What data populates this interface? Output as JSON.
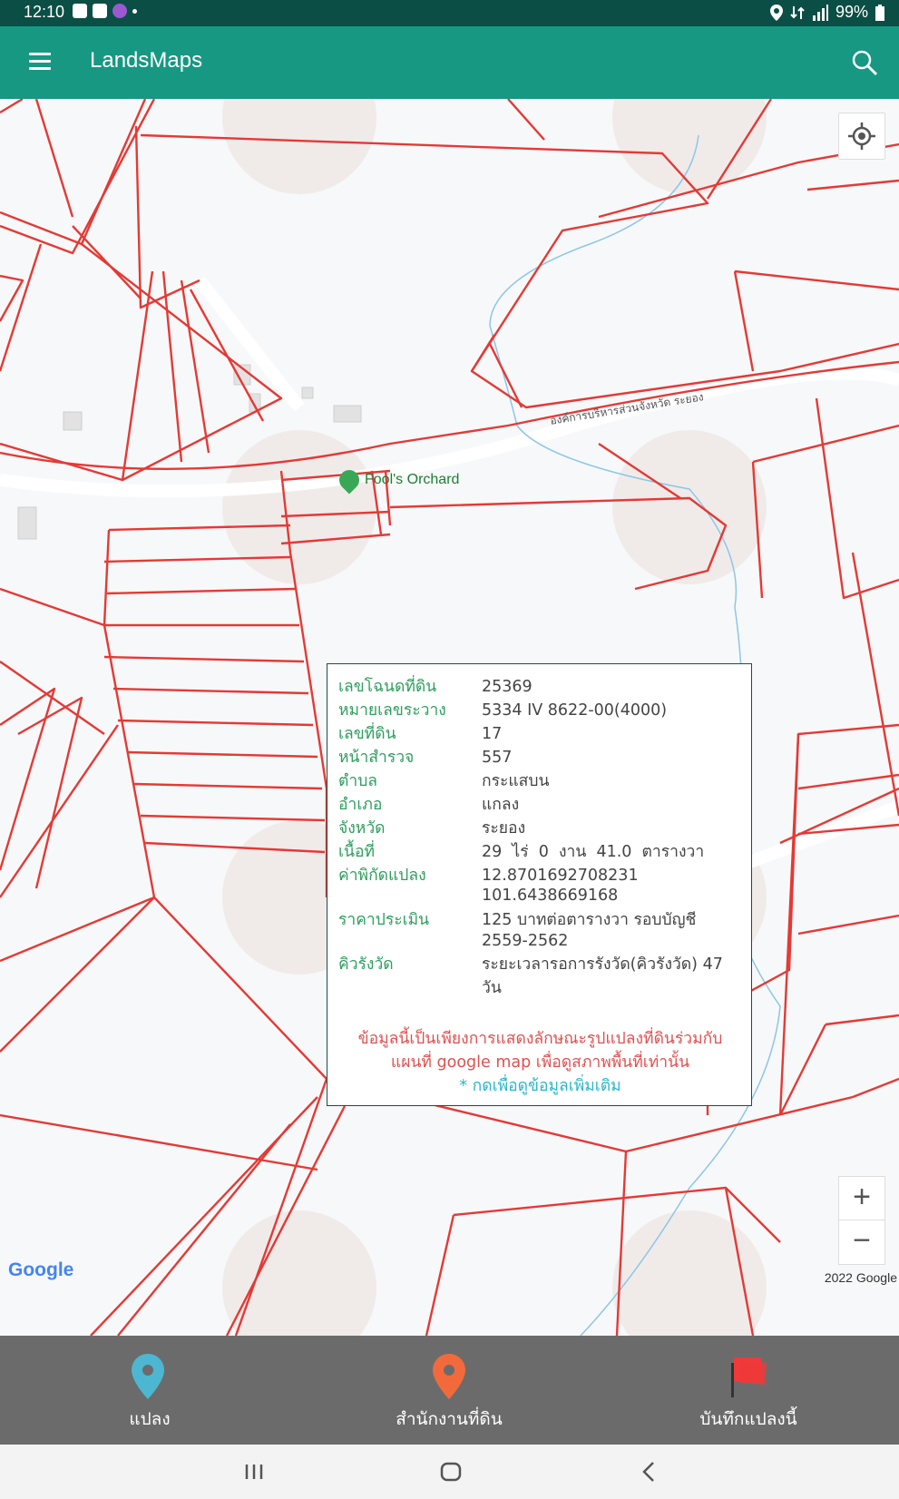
{
  "status_bar": {
    "time": "12:10",
    "battery": "99%"
  },
  "app_bar": {
    "title": "LandsMaps"
  },
  "map": {
    "poi_label": "Fool's Orchard",
    "road_label": "องค์การบริหารส่วนจังหวัด ระยอง",
    "google_logo": "Google",
    "copyright": "2022 Google",
    "zoom_in": "+",
    "zoom_out": "−"
  },
  "info_window": {
    "rows": [
      {
        "label": "เลขโฉนดที่ดิน",
        "value": "25369"
      },
      {
        "label": "หมายเลขระวาง",
        "value": "5334 IV 8622-00(4000)"
      },
      {
        "label": "เลขที่ดิน",
        "value": "17"
      },
      {
        "label": "หน้าสำรวจ",
        "value": "557"
      },
      {
        "label": "ตำบล",
        "value": "กระแสบน"
      },
      {
        "label": "อำเภอ",
        "value": "แกลง"
      },
      {
        "label": "จังหวัด",
        "value": "ระยอง"
      },
      {
        "label": "เนื้อที่",
        "value": "29  ไร่  0  งาน  41.0  ตารางวา"
      },
      {
        "label": "ค่าพิกัดแปลง",
        "value": "12.8701692708231",
        "value2": "101.6438669168"
      },
      {
        "label": "ราคาประเมิน",
        "value": "125 บาทต่อตารางวา รอบบัญชี",
        "value2": "2559-2562"
      },
      {
        "label": "คิวรังวัด",
        "value": "ระยะเวลารอการรังวัด(คิวรังวัด) 47",
        "value2": "วัน"
      }
    ],
    "note_line1": "ข้อมูลนี้เป็นเพียงการแสดงลักษณะรูปแปลงที่ดินร่วมกับ",
    "note_line2": "แผนที่ google map เพื่อดูสภาพพื้นที่เท่านั้น",
    "note_more": "* กดเพื่อดูข้อมูลเพิ่มเติม"
  },
  "bottom_tabs": {
    "parcel": "แปลง",
    "land_office": "สำนักงานที่ดิน",
    "save_parcel": "บันทึกแปลงนี้"
  },
  "colors": {
    "status_bar": "#0b4e45",
    "app_bar": "#169883",
    "parcel_lines": "#e53935",
    "label_green": "#2e9e5e",
    "note_red": "#e05050",
    "note_cyan": "#29b6c9",
    "pin_blue": "#4db6d0",
    "pin_orange": "#f26a3c",
    "flag_red": "#ee3a3a"
  }
}
